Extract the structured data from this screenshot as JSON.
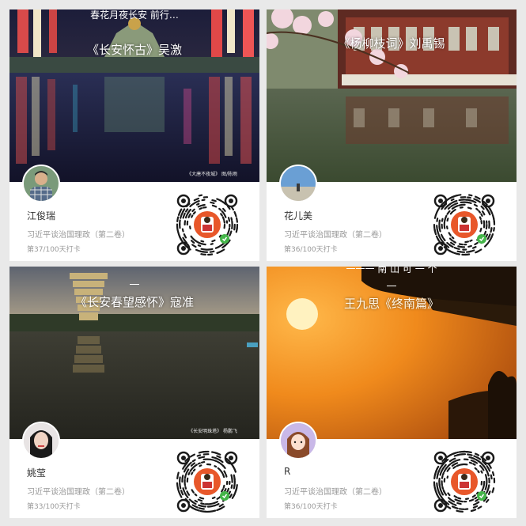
{
  "cards": [
    {
      "caption": "《长安怀古》吴激",
      "caption_top": "春花月夜长安 前行…",
      "watermark": "《大唐不夜城》 图/陈雨",
      "name": "江俊瑞",
      "book": "习近平谈治国理政（第二卷）",
      "progress": "第37/100天打卡",
      "avatar_icon": "man-portrait"
    },
    {
      "caption": "《杨柳枝词》刘禹锡",
      "caption_top": "",
      "watermark": "",
      "name": "花儿美",
      "book": "习近平谈治国理政（第二卷）",
      "progress": "第36/100天打卡",
      "avatar_icon": "beach-sky"
    },
    {
      "caption": "《长安春望感怀》寇准",
      "caption_top": "",
      "watermark": "《长安明珠塔》 杨鹏飞",
      "name": "姚莹",
      "book": "习近平谈治国理政（第二卷）",
      "progress": "第33/100天打卡",
      "avatar_icon": "woman-portrait"
    },
    {
      "caption": "王九思《终南篇》",
      "caption_top": "",
      "watermark": "",
      "name": "R",
      "book": "习近平谈治国理政（第二卷）",
      "progress": "第36/100天打卡",
      "avatar_icon": "cartoon-girl"
    }
  ],
  "colors": {
    "card_bg": "#ffffff",
    "page_bg": "#e9e9e9",
    "muted_text": "#999999",
    "name_text": "#333333",
    "wechat_green": "#44b549",
    "qr_center_orange": "#e8572a"
  },
  "qr_icon": "wechat-miniprogram-code-icon"
}
